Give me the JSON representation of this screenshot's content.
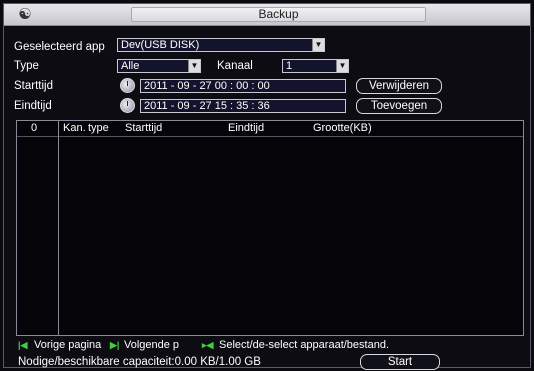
{
  "window": {
    "title": "Backup"
  },
  "form": {
    "device_label": "Geselecteerd app",
    "device_value": "Dev(USB DISK)",
    "type_label": "Type",
    "type_value": "Alle",
    "channel_label": "Kanaal",
    "channel_value": "1",
    "start_label": "Starttijd",
    "start_value": "2011 - 09 - 27   00 : 00 : 00",
    "end_label": "Eindtijd",
    "end_value": "2011 - 09 - 27   15 : 35 : 36",
    "delete_button": "Verwijderen",
    "add_button": "Toevoegen"
  },
  "table": {
    "columns": [
      "0",
      "Kan.",
      "type",
      "Starttijd",
      "Eindtijd",
      "Grootte(KB)"
    ],
    "rows": []
  },
  "nav": {
    "prev_label": "Vorige pagina",
    "next_label": "Volgende p",
    "select_label": "Select/de-select apparaat/bestand."
  },
  "footer": {
    "capacity_text": "Nodige/beschikbare capaciteit:0.00 KB/1.00 GB",
    "start_button": "Start"
  },
  "colors": {
    "background": "#0c0c12",
    "nav_icon": "#3bd23b",
    "titlebar": "#d8d8de"
  },
  "icons": [
    "logo-icon",
    "clock-icon",
    "dropdown-arrow-icon",
    "prev-page-icon",
    "next-page-icon",
    "select-icon"
  ]
}
